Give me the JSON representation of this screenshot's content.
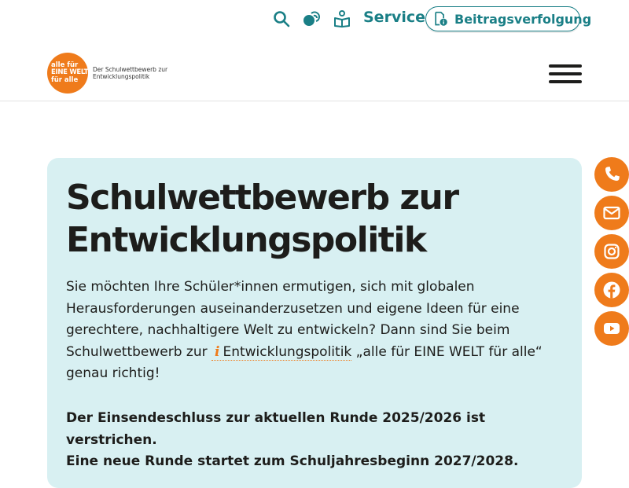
{
  "topbar": {
    "icons": [
      "search-icon",
      "community-icon",
      "reading-icon"
    ],
    "service_label": "Service",
    "tracking_label": "Beitragsverfolgung",
    "tracking_icon": "document-info-icon"
  },
  "header": {
    "logo": {
      "circle_lines": [
        "alle für",
        "EINE WELT",
        "für alle"
      ],
      "subtitle_lines": [
        "Der Schulwettbewerb zur",
        "Entwicklungspolitik"
      ]
    },
    "menu_icon": "hamburger-icon"
  },
  "hero": {
    "title_line1": "Schulwettbewerb zur",
    "title_line2": "Entwicklungspolitik",
    "intro_part1": "Sie möchten Ihre Schüler*innen ermutigen, sich mit globalen Herausforderungen auseinanderzusetzen und eigene Ideen für eine gerechtere, nachhaltigere Welt zu entwickeln? Dann sind Sie beim Schulwettbewerb zur ",
    "info_marker": "i",
    "info_link": "Entwicklungspolitik",
    "intro_part2": " „alle für EINE WELT für alle“ genau richtig!",
    "deadline_line1": "Der Einsendeschluss zur aktuellen Runde 2025/2026 ist verstrichen.",
    "deadline_line2": "Eine neue Runde startet zum Schuljahresbeginn 2027/2028."
  },
  "social": [
    "phone-icon",
    "email-icon",
    "instagram-icon",
    "facebook-icon",
    "youtube-icon"
  ],
  "colors": {
    "teal": "#1a7f86",
    "orange": "#ef7b1b",
    "hero_bg": "#d8f0f2",
    "text": "#1d1d1b"
  }
}
